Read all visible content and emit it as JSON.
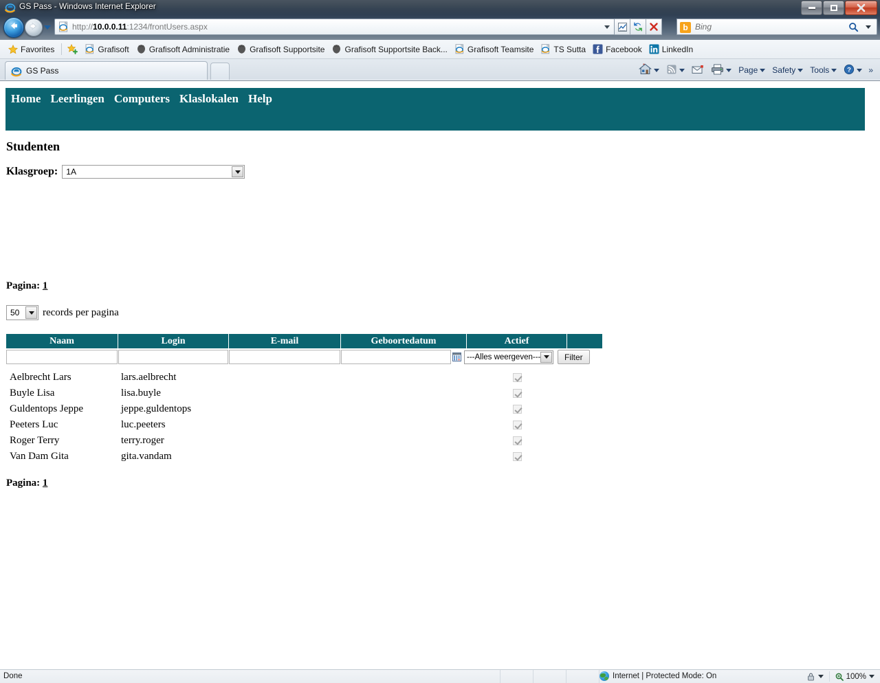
{
  "window": {
    "title": "GS Pass - Windows Internet Explorer",
    "minimize_label": "Minimize",
    "maximize_label": "Maximize",
    "close_label": "Close"
  },
  "browser": {
    "back_label": "Back",
    "forward_label": "Forward",
    "history_label": "Recent Pages",
    "address": {
      "protocol": "http://",
      "host": "10.0.0.11",
      "rest": ":1234/frontUsers.aspx",
      "full": "http://10.0.0.11:1234/frontUsers.aspx"
    },
    "compat_label": "Compatibility View",
    "refresh_label": "Refresh",
    "stop_label": "Stop",
    "search": {
      "provider": "Bing",
      "logo_letter": "b",
      "placeholder": "Bing"
    },
    "favorites": {
      "button_label": "Favorites",
      "items": [
        {
          "label": "Grafisoft",
          "icon": "ie-page-icon"
        },
        {
          "label": "Grafisoft Administratie",
          "icon": "firefox-icon"
        },
        {
          "label": "Grafisoft Supportsite",
          "icon": "firefox-icon"
        },
        {
          "label": "Grafisoft Supportsite Back...",
          "icon": "firefox-icon"
        },
        {
          "label": "Grafisoft Teamsite",
          "icon": "ie-page-icon"
        },
        {
          "label": "TS Sutta",
          "icon": "ie-page-icon"
        },
        {
          "label": "Facebook",
          "icon": "facebook-icon"
        },
        {
          "label": "LinkedIn",
          "icon": "linkedin-icon"
        }
      ]
    },
    "tab": {
      "label": "GS Pass"
    },
    "new_tab_label": "New Tab",
    "command_bar": {
      "home_label": "Home",
      "feeds_label": "Feeds",
      "mail_label": "Read Mail",
      "print_label": "Print",
      "page_label": "Page",
      "safety_label": "Safety",
      "tools_label": "Tools",
      "help_label": "Help",
      "overflow_label": "»"
    }
  },
  "page": {
    "nav": [
      {
        "label": "Home"
      },
      {
        "label": "Leerlingen"
      },
      {
        "label": "Computers"
      },
      {
        "label": "Klaslokalen"
      },
      {
        "label": "Help"
      }
    ],
    "heading": "Studenten",
    "klasgroep": {
      "label": "Klasgroep:",
      "value": "1A"
    },
    "pagination_top": {
      "label": "Pagina:",
      "current": "1"
    },
    "pagination_bottom": {
      "label": "Pagina:",
      "current": "1"
    },
    "records": {
      "value": "50",
      "label": "records per pagina"
    },
    "table": {
      "columns": [
        "Naam",
        "Login",
        "E-mail",
        "Geboortedatum",
        "Actief"
      ],
      "filters": {
        "naam": "",
        "login": "",
        "email": "",
        "geboortedatum": "",
        "actief_value": "---Alles weergeven---",
        "calendar_icon": "calendar-icon",
        "filter_button": "Filter"
      },
      "rows": [
        {
          "naam": "Aelbrecht Lars",
          "login": "lars.aelbrecht",
          "email": "",
          "geboortedatum": "",
          "actief": true
        },
        {
          "naam": "Buyle Lisa",
          "login": "lisa.buyle",
          "email": "",
          "geboortedatum": "",
          "actief": true
        },
        {
          "naam": "Guldentops Jeppe",
          "login": "jeppe.guldentops",
          "email": "",
          "geboortedatum": "",
          "actief": true
        },
        {
          "naam": "Peeters Luc",
          "login": "luc.peeters",
          "email": "",
          "geboortedatum": "",
          "actief": true
        },
        {
          "naam": "Roger Terry",
          "login": "terry.roger",
          "email": "",
          "geboortedatum": "",
          "actief": true
        },
        {
          "naam": "Van Dam Gita",
          "login": "gita.vandam",
          "email": "",
          "geboortedatum": "",
          "actief": true
        }
      ]
    }
  },
  "status": {
    "text": "Done",
    "zone": "Internet | Protected Mode: On",
    "zoom": "100%"
  },
  "colors": {
    "teal": "#0b6470",
    "nav_text": "#ffffff",
    "page_bg": "#ffffff",
    "close_button": "#bd3a1f"
  }
}
